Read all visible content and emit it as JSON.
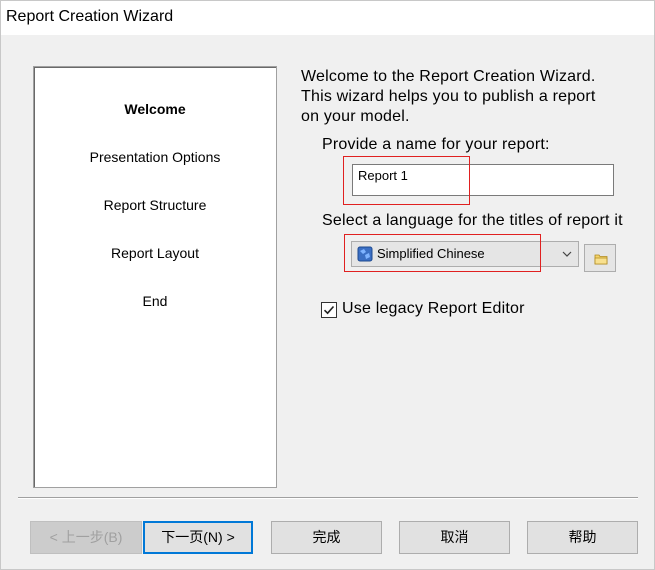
{
  "window": {
    "title": "Report Creation Wizard"
  },
  "steps": [
    {
      "label": "Welcome",
      "active": true
    },
    {
      "label": "Presentation Options",
      "active": false
    },
    {
      "label": "Report Structure",
      "active": false
    },
    {
      "label": "Report Layout",
      "active": false
    },
    {
      "label": "End",
      "active": false
    }
  ],
  "intro": {
    "line1": "Welcome to the Report Creation Wizard.",
    "line2": "This wizard helps you to publish a report",
    "line3": "on your model."
  },
  "name_field": {
    "label": "Provide a name for your report:",
    "value": "Report 1"
  },
  "language_field": {
    "label": "Select a language for the titles of report it",
    "selected": "Simplified Chinese"
  },
  "legacy_editor": {
    "label": "Use legacy Report Editor",
    "checked": true
  },
  "buttons": {
    "back": "< 上一步(B)",
    "next": "下一页(N) >",
    "finish": "完成",
    "cancel": "取消",
    "help": "帮助"
  },
  "colors": {
    "highlight": "#e02020",
    "default_button_border": "#0078d7"
  }
}
